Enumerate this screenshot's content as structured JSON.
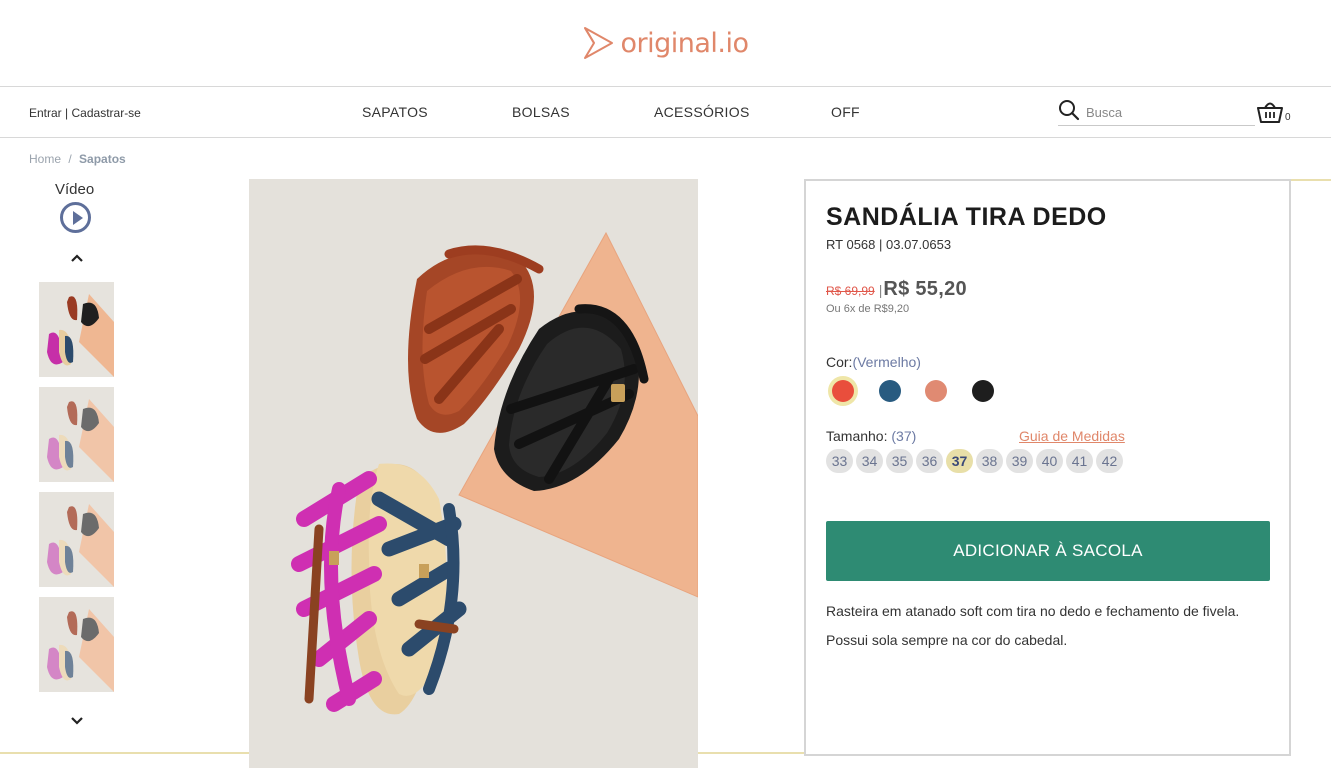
{
  "logo": {
    "text": "original.io",
    "icon": "logo-play-icon",
    "color": "#e0876a"
  },
  "account": {
    "login": "Entrar",
    "separator": "|",
    "signup": "Cadastrar-se"
  },
  "menu": [
    {
      "label": "SAPATOS"
    },
    {
      "label": "BOLSAS"
    },
    {
      "label": "ACESSÓRIOS"
    },
    {
      "label": "OFF"
    }
  ],
  "search": {
    "placeholder": "Busca",
    "icon": "search-icon"
  },
  "cart": {
    "icon": "shopping-basket-icon",
    "count": "0"
  },
  "breadcrumb": {
    "home": "Home",
    "separator": "/",
    "current": "Sapatos"
  },
  "gallery": {
    "video_label": "Vídeo",
    "video_icon": "play-circle-icon",
    "up_icon": "chevron-up-icon",
    "down_icon": "chevron-down-icon",
    "thumbnail_count": 4
  },
  "product": {
    "title": "SANDÁLIA TIRA DEDO",
    "ref": "RT 0568 | 03.07.0653",
    "old_price": "R$ 69,99",
    "price_separator": "|",
    "price": "R$ 55,20",
    "installments": "Ou 6x de R$9,20",
    "color_label": "Cor:",
    "color_value": "(Vermelho)",
    "colors": [
      {
        "name": "Vermelho",
        "hex": "#e94e3c",
        "selected": true
      },
      {
        "name": "Azul",
        "hex": "#285b80",
        "selected": false
      },
      {
        "name": "Nude",
        "hex": "#e08a72",
        "selected": false
      },
      {
        "name": "Preto",
        "hex": "#1e1e1e",
        "selected": false
      }
    ],
    "size_label": "Tamanho:",
    "size_value": "(37)",
    "size_guide": "Guia de Medidas",
    "sizes": [
      "33",
      "34",
      "35",
      "36",
      "37",
      "38",
      "39",
      "40",
      "41",
      "42"
    ],
    "selected_size": "37",
    "add_to_cart": "ADICIONAR À SACOLA",
    "description": [
      "Rasteira em atanado soft com tira no dedo e fechamento de fivela.",
      "Possui sola sempre na cor do cabedal."
    ]
  },
  "colors": {
    "accent": "#2e8b73",
    "brand": "#e0876a",
    "highlight": "#e8dfa8"
  }
}
